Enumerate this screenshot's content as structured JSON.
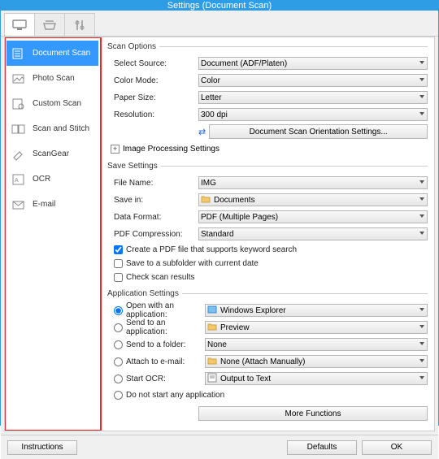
{
  "window": {
    "title": "Settings (Document Scan)"
  },
  "sidebar": {
    "items": [
      {
        "label": "Document Scan"
      },
      {
        "label": "Photo Scan"
      },
      {
        "label": "Custom Scan"
      },
      {
        "label": "Scan and Stitch"
      },
      {
        "label": "ScanGear"
      },
      {
        "label": "OCR"
      },
      {
        "label": "E-mail"
      }
    ]
  },
  "scanOptions": {
    "legend": "Scan Options",
    "sourceLabel": "Select Source:",
    "sourceValue": "Document (ADF/Platen)",
    "colorLabel": "Color Mode:",
    "colorValue": "Color",
    "paperLabel": "Paper Size:",
    "paperValue": "Letter",
    "resLabel": "Resolution:",
    "resValue": "300 dpi",
    "orientBtn": "Document Scan Orientation Settings...",
    "imgProc": "Image Processing Settings"
  },
  "saveSettings": {
    "legend": "Save Settings",
    "fileLabel": "File Name:",
    "fileValue": "IMG",
    "saveInLabel": "Save in:",
    "saveInValue": "Documents",
    "formatLabel": "Data Format:",
    "formatValue": "PDF (Multiple Pages)",
    "compLabel": "PDF Compression:",
    "compValue": "Standard",
    "chkKeyword": "Create a PDF file that supports keyword search",
    "chkSubfolder": "Save to a subfolder with current date",
    "chkCheck": "Check scan results"
  },
  "appSettings": {
    "legend": "Application Settings",
    "r1": "Open with an application:",
    "r1v": "Windows Explorer",
    "r2": "Send to an application:",
    "r2v": "Preview",
    "r3": "Send to a folder:",
    "r3v": "None",
    "r4": "Attach to e-mail:",
    "r4v": "None (Attach Manually)",
    "r5": "Start OCR:",
    "r5v": "Output to Text",
    "r6": "Do not start any application",
    "moreBtn": "More Functions"
  },
  "footer": {
    "instructions": "Instructions",
    "defaults": "Defaults",
    "ok": "OK"
  }
}
